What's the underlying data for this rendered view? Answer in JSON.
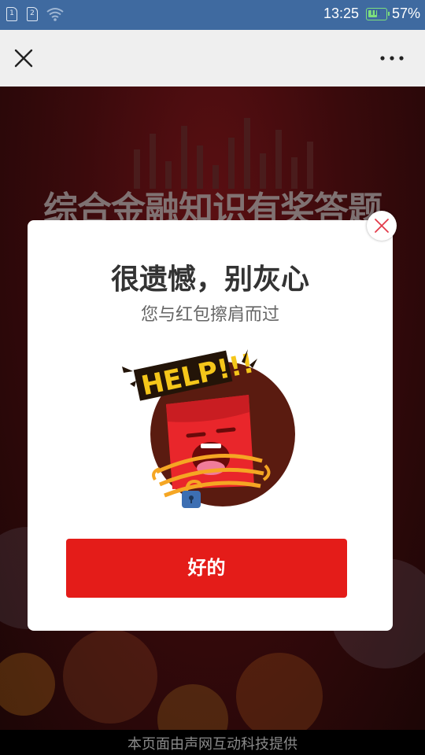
{
  "status_bar": {
    "sim1": "1",
    "sim2": "2",
    "time": "13:25",
    "battery_percent": "57%",
    "battery_level": 0.57,
    "icons": [
      "sim1-icon",
      "sim2-icon",
      "wifi-icon",
      "battery-icon"
    ]
  },
  "nav": {
    "icons": [
      "close-icon",
      "more-icon"
    ]
  },
  "background": {
    "title": "综合金融知识有奖答题"
  },
  "modal": {
    "title": "很遗憾，别灰心",
    "subtitle": "您与红包擦肩而过",
    "illustration_text": "HELP!!!",
    "ok_label": "好的",
    "close_icon": "close-icon"
  },
  "footer": {
    "text": "本页面由声网互动科技提供"
  },
  "colors": {
    "status_bar": "#3f6aa0",
    "accent": "#e41c19",
    "battery": "#7de07d"
  }
}
